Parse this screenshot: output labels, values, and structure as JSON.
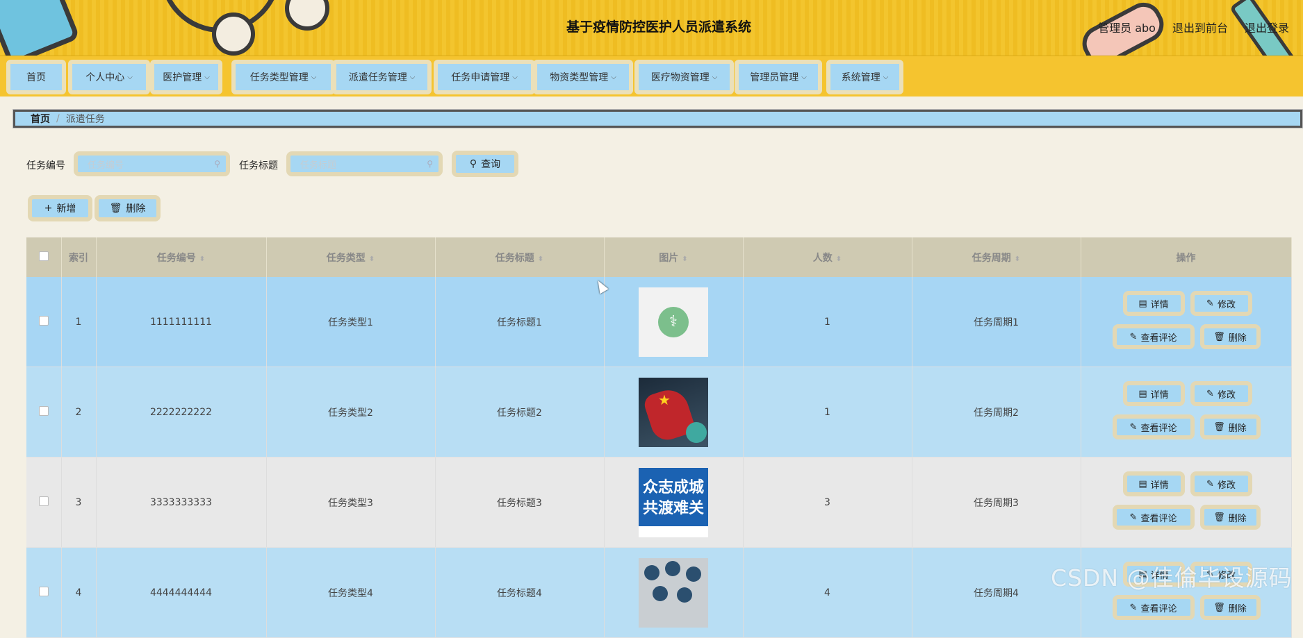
{
  "header": {
    "title": "基于疫情防控医护人员派遣系统",
    "admin_label": "管理员 abo",
    "front_link": "退出到前台",
    "logout_link": "退出登录"
  },
  "nav": {
    "items": [
      {
        "label": "首页",
        "has_dropdown": false
      },
      {
        "label": "个人中心",
        "has_dropdown": true
      },
      {
        "label": "医护管理",
        "has_dropdown": true
      },
      {
        "label": "任务类型管理",
        "has_dropdown": true
      },
      {
        "label": "派遣任务管理",
        "has_dropdown": true
      },
      {
        "label": "任务申请管理",
        "has_dropdown": true
      },
      {
        "label": "物资类型管理",
        "has_dropdown": true
      },
      {
        "label": "医疗物资管理",
        "has_dropdown": true
      },
      {
        "label": "管理员管理",
        "has_dropdown": true
      },
      {
        "label": "系统管理",
        "has_dropdown": true
      }
    ]
  },
  "breadcrumb": {
    "home": "首页",
    "separator": "/",
    "current": "派遣任务"
  },
  "search": {
    "task_no_label": "任务编号",
    "task_no_placeholder": "任务编号",
    "task_title_label": "任务标题",
    "task_title_placeholder": "任务标题",
    "query_button": "查询"
  },
  "toolbar": {
    "add_button": "新增",
    "delete_button": "删除"
  },
  "table": {
    "columns": [
      "索引",
      "任务编号",
      "任务类型",
      "任务标题",
      "图片",
      "人数",
      "任务周期",
      "操作"
    ],
    "rows": [
      {
        "index": "1",
        "task_no": "1111111111",
        "task_type": "任务类型1",
        "task_title": "任务标题1",
        "image": "doctor-avatar",
        "people": "1",
        "period": "任务周期1"
      },
      {
        "index": "2",
        "task_no": "2222222222",
        "task_type": "任务类型2",
        "task_title": "任务标题2",
        "image": "fist-virus-poster",
        "people": "1",
        "period": "任务周期2"
      },
      {
        "index": "3",
        "task_no": "3333333333",
        "task_type": "任务类型3",
        "task_title": "任务标题3",
        "image": "slogan-poster",
        "people": "3",
        "period": "任务周期3"
      },
      {
        "index": "4",
        "task_no": "4444444444",
        "task_type": "任务类型4",
        "task_title": "任务标题4",
        "image": "medical-icons-poster",
        "people": "4",
        "period": "任务周期4"
      }
    ],
    "row_actions": {
      "detail": "详情",
      "edit": "修改",
      "comments": "查看评论",
      "delete": "删除"
    }
  },
  "poster3_text": {
    "line1": "众志成城",
    "line2": "共渡难关"
  },
  "watermark": "CSDN @佳倫毕设源码",
  "colors": {
    "header_yellow": "#f3c52e",
    "button_blue": "#a6d7f3",
    "button_border": "#e3d8b4",
    "table_header": "#cfcab2",
    "page_bg": "#f4f0e4"
  }
}
